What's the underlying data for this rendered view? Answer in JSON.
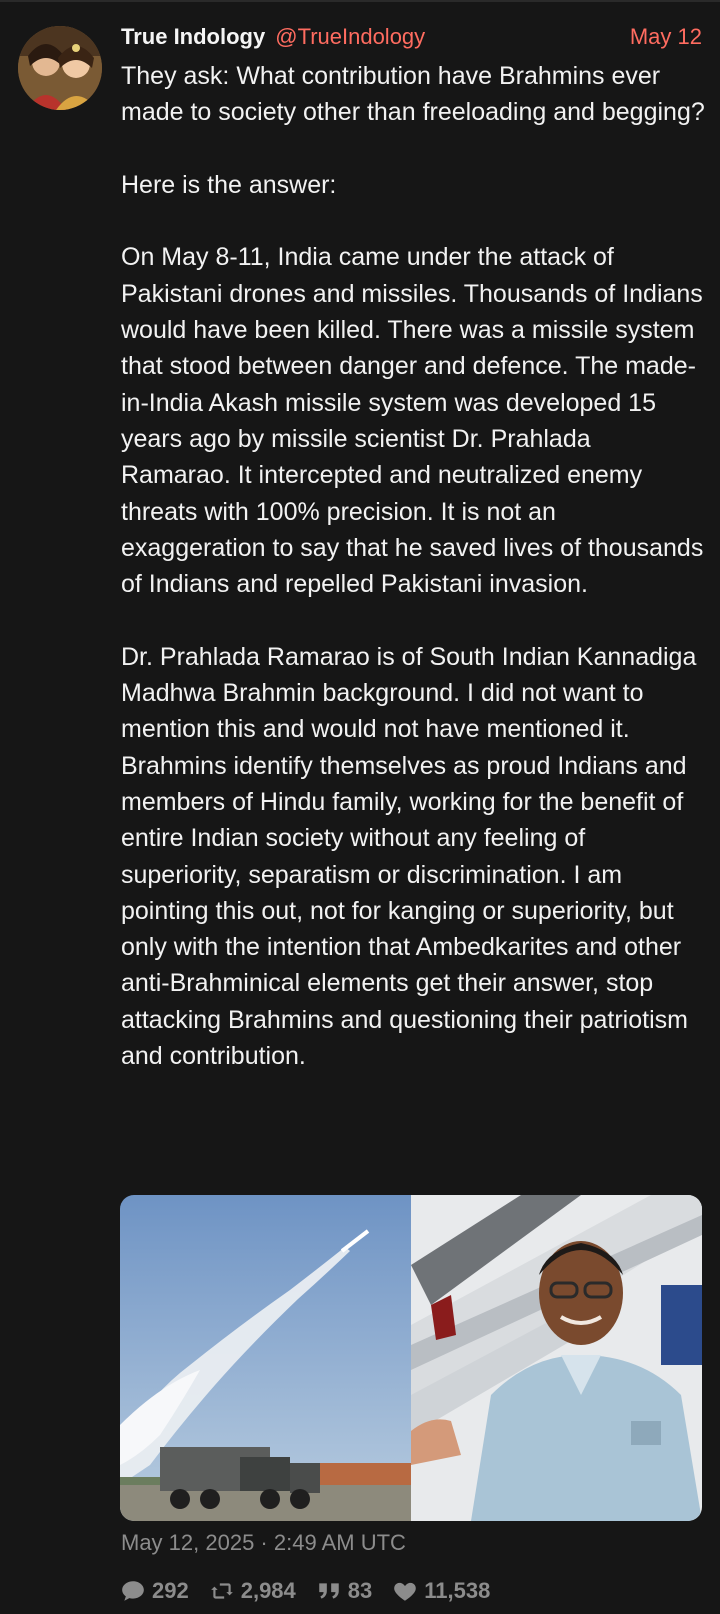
{
  "tweet": {
    "author": {
      "fullname": "True Indology",
      "handle": "@TrueIndology"
    },
    "date_short": "May 12",
    "paragraphs": [
      "They ask: What contribution have Brahmins ever made to society other than freeloading and begging?",
      "Here is the answer:",
      "On May 8-11, India came under the attack of Pakistani drones and missiles. Thousands of Indians would have been killed. There was a missile system that stood between danger and defence. The made-in-India Akash missile system was developed 15 years ago by missile scientist Dr. Prahlada Ramarao. It intercepted and neutralized enemy threats with 100% precision. It is not an exaggeration to say that he saved lives of thousands of Indians and repelled Pakistani invasion.",
      "Dr. Prahlada Ramarao is of South Indian Kannadiga Madhwa Brahmin background. I did not want to mention this and would not have mentioned it. Brahmins identify themselves as proud Indians and members of Hindu family, working for the benefit of entire Indian society without any feeling of superiority, separatism or discrimination. I am pointing this out, not for kanging or superiority, but only with the intention that Ambedkarites and other anti-Brahminical elements get their answer, stop attacking Brahmins and questioning their patriotism and contribution."
    ],
    "published": "May 12, 2025 · 2:49 AM UTC",
    "stats": {
      "replies": "292",
      "retweets": "2,984",
      "quotes": "83",
      "likes": "11,538"
    }
  },
  "icons": {
    "reply": "comment-icon",
    "retweet": "retweet-icon",
    "quote": "quote-icon",
    "like": "heart-icon"
  },
  "colors": {
    "background": "#161616",
    "accent": "#ff6c60",
    "text": "#f2f2f2",
    "muted": "#8c8c8c"
  }
}
